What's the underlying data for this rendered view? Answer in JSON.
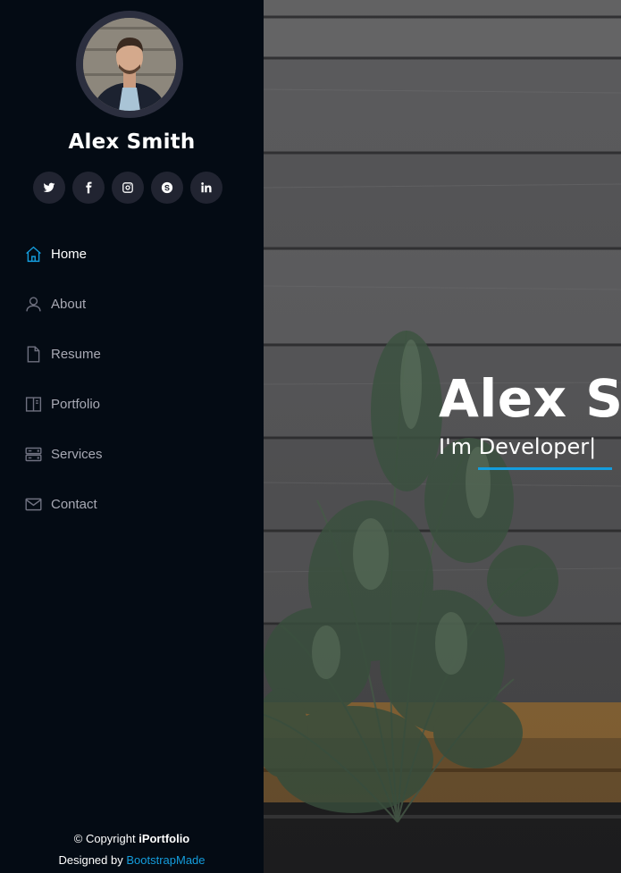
{
  "profile": {
    "name": "Alex Smith"
  },
  "social": [
    {
      "icon": "twitter-icon"
    },
    {
      "icon": "facebook-icon"
    },
    {
      "icon": "instagram-icon"
    },
    {
      "icon": "skype-icon"
    },
    {
      "icon": "linkedin-icon"
    }
  ],
  "nav": {
    "items": [
      {
        "label": "Home",
        "icon": "house-icon",
        "active": true
      },
      {
        "label": "About",
        "icon": "person-icon",
        "active": false
      },
      {
        "label": "Resume",
        "icon": "file-icon",
        "active": false
      },
      {
        "label": "Portfolio",
        "icon": "book-icon",
        "active": false
      },
      {
        "label": "Services",
        "icon": "server-icon",
        "active": false
      },
      {
        "label": "Contact",
        "icon": "envelope-icon",
        "active": false
      }
    ]
  },
  "hero": {
    "title": "Alex Smith",
    "subtitle_prefix": "I'm ",
    "subtitle_typed": "Developer",
    "cursor": "|"
  },
  "footer": {
    "copyright_prefix": "© Copyright ",
    "brand": "iPortfolio",
    "designed_prefix": "Designed by ",
    "designer": "BootstrapMade"
  },
  "colors": {
    "sidebar_bg": "#040b14",
    "accent": "#149ddd",
    "social_bg": "#212431",
    "nav_text": "#a8a9b4"
  }
}
